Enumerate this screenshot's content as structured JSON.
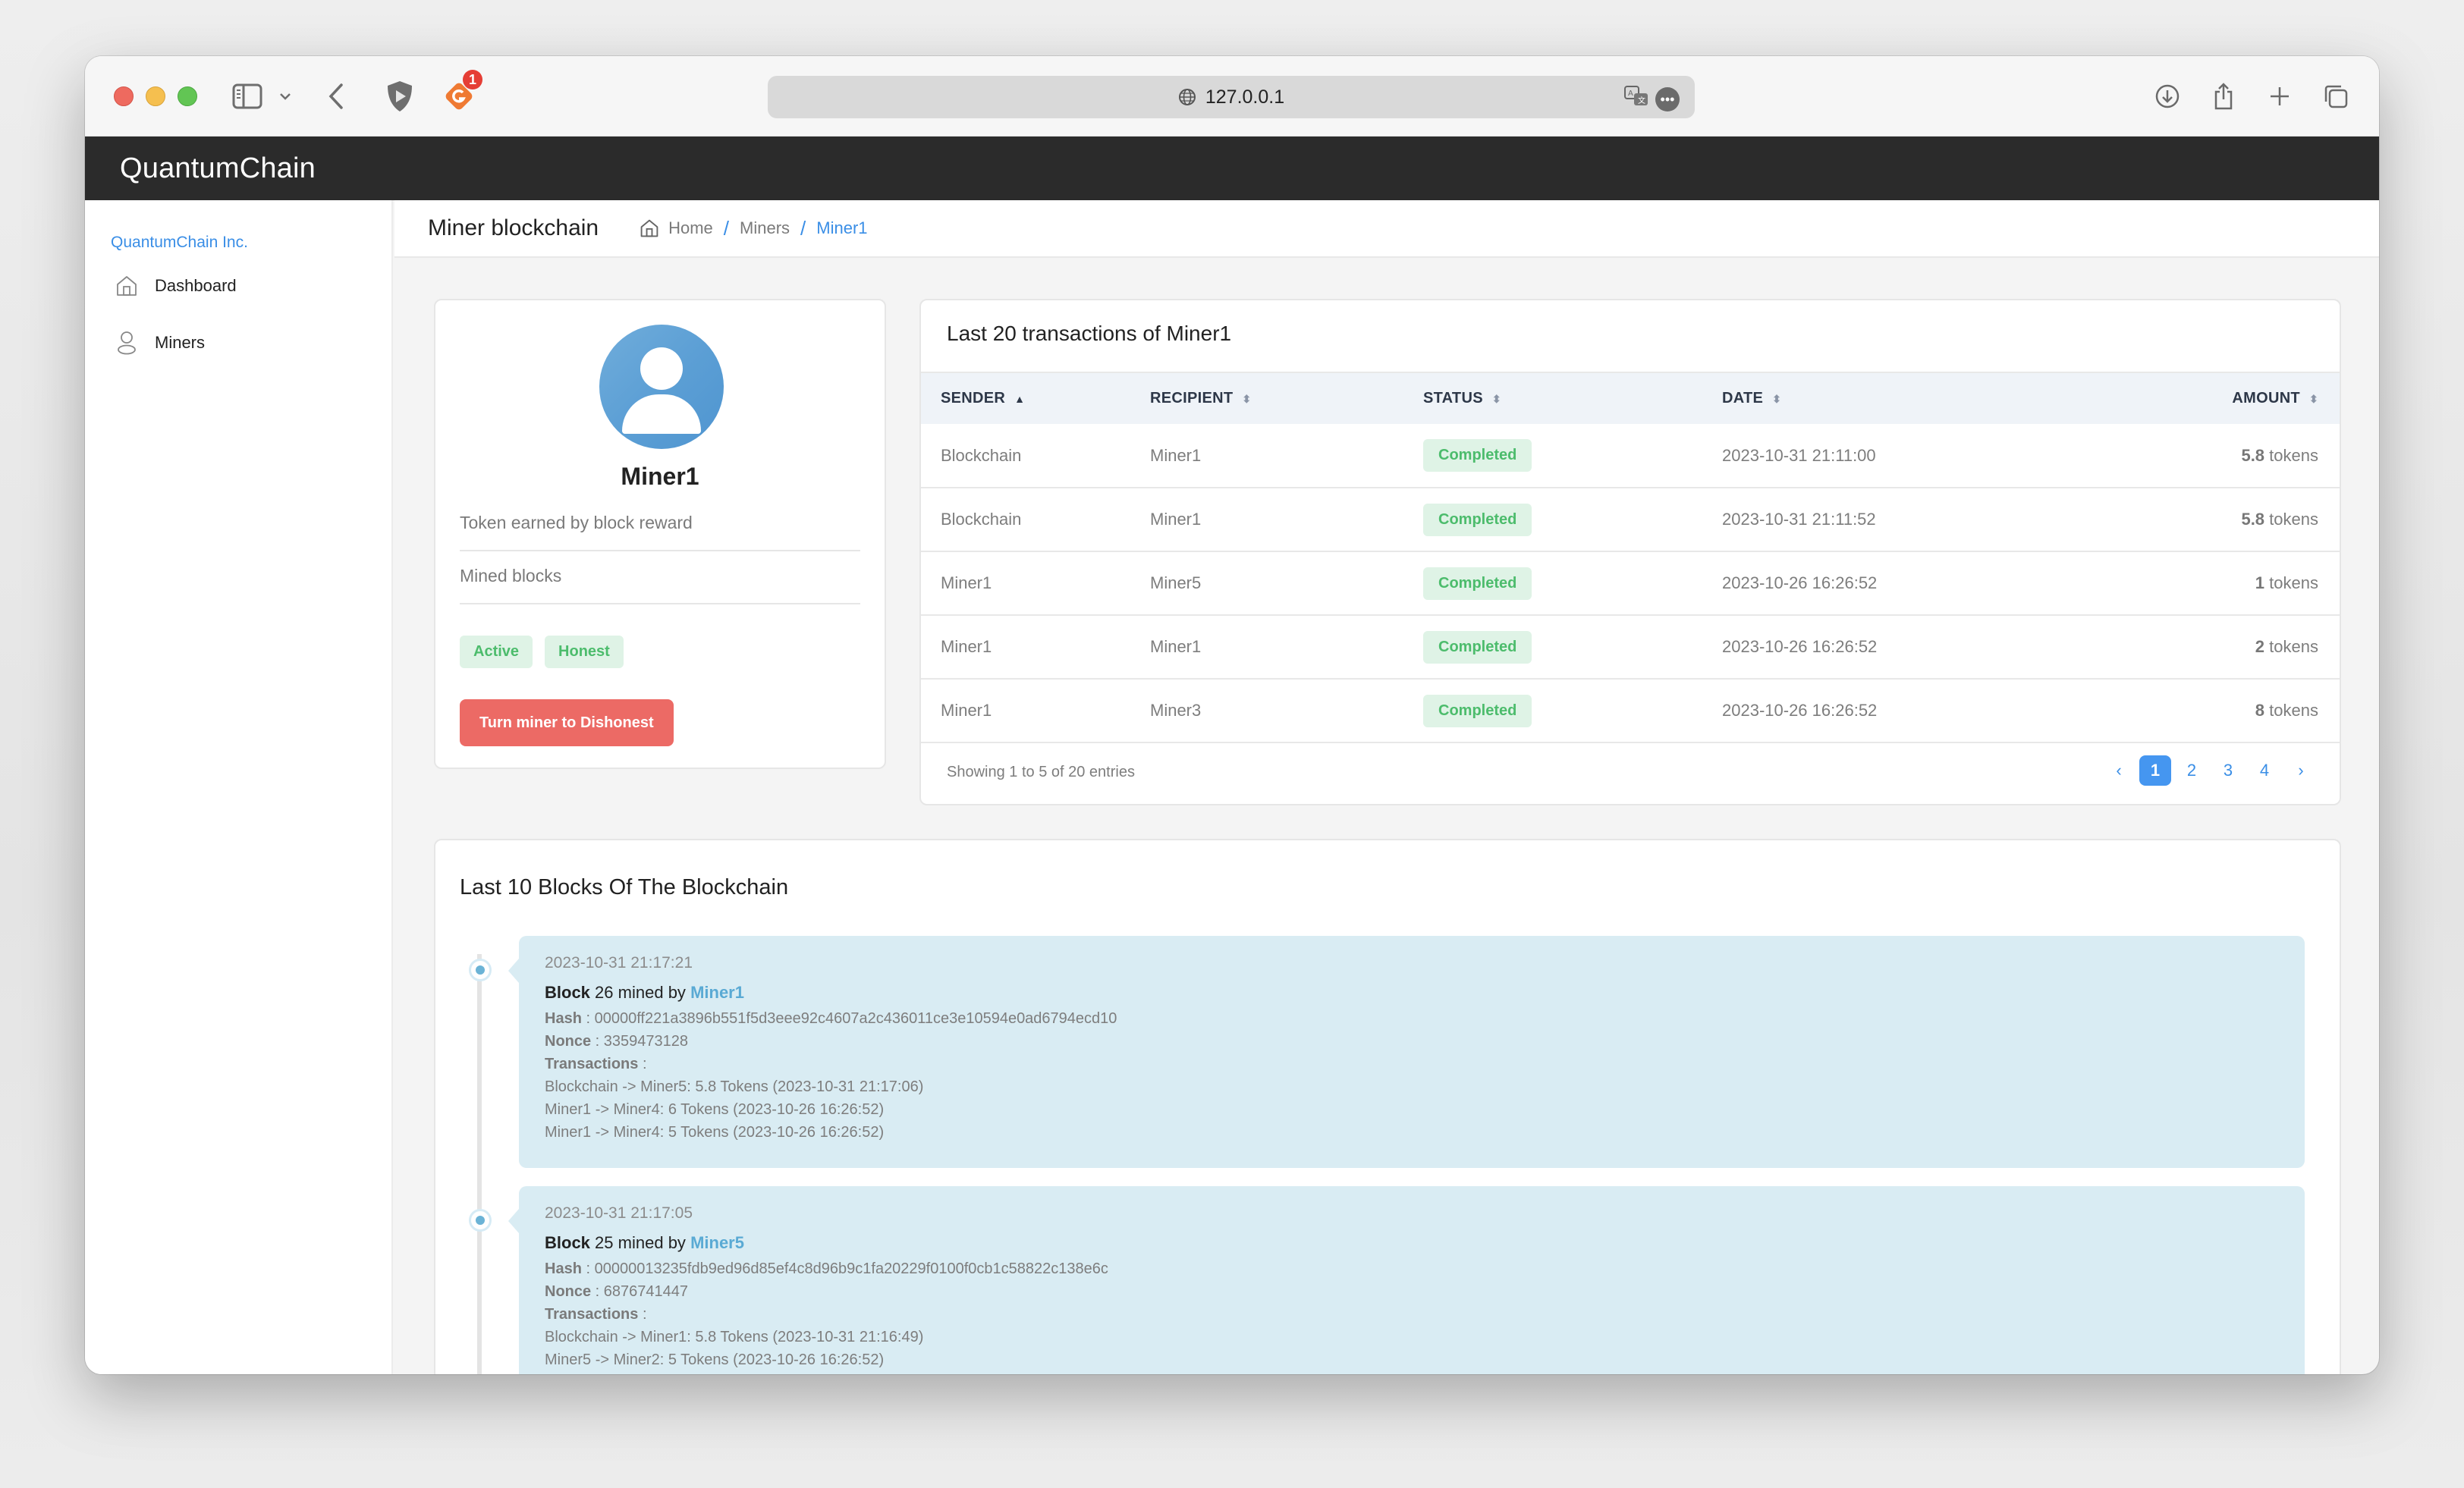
{
  "browser": {
    "url": "127.0.0.1",
    "extension_badge_count": "1"
  },
  "navbar": {
    "brand": "QuantumChain"
  },
  "sidebar": {
    "company": "QuantumChain Inc.",
    "items": [
      {
        "label": "Dashboard",
        "icon": "home-icon"
      },
      {
        "label": "Miners",
        "icon": "user-icon"
      }
    ]
  },
  "header": {
    "title": "Miner blockchain",
    "breadcrumb": [
      "Home",
      "Miners",
      "Miner1"
    ]
  },
  "profile": {
    "name": "Miner1",
    "reward_label": "Token earned by block reward",
    "mined_label": "Mined blocks",
    "tags": [
      "Active",
      "Honest"
    ],
    "action_label": "Turn miner to Dishonest",
    "colors": {
      "tag_text": "#4cbc6c",
      "tag_bg": "#dff3e6",
      "danger": "#ec6a65"
    }
  },
  "transactions": {
    "title": "Last 20 transactions of Miner1",
    "columns": [
      "SENDER",
      "RECIPIENT",
      "STATUS",
      "DATE",
      "AMOUNT"
    ],
    "sorted_column": "SENDER",
    "sort_direction": "asc",
    "rows": [
      {
        "sender": "Blockchain",
        "recipient": "Miner1",
        "status": "Completed",
        "date": "2023-10-31 21:11:00",
        "amount": "5.8",
        "unit": "tokens"
      },
      {
        "sender": "Blockchain",
        "recipient": "Miner1",
        "status": "Completed",
        "date": "2023-10-31 21:11:52",
        "amount": "5.8",
        "unit": "tokens"
      },
      {
        "sender": "Miner1",
        "recipient": "Miner5",
        "status": "Completed",
        "date": "2023-10-26 16:26:52",
        "amount": "1",
        "unit": "tokens"
      },
      {
        "sender": "Miner1",
        "recipient": "Miner1",
        "status": "Completed",
        "date": "2023-10-26 16:26:52",
        "amount": "2",
        "unit": "tokens"
      },
      {
        "sender": "Miner1",
        "recipient": "Miner3",
        "status": "Completed",
        "date": "2023-10-26 16:26:52",
        "amount": "8",
        "unit": "tokens"
      }
    ],
    "footer": "Showing 1 to 5 of 20 entries",
    "pagination": {
      "prev": "‹",
      "pages": [
        "1",
        "2",
        "3",
        "4"
      ],
      "current": "1",
      "next": "›"
    }
  },
  "blocks": {
    "title": "Last 10 Blocks Of The Blockchain",
    "labels": {
      "block": "Block",
      "mined_by": "mined by",
      "hash": "Hash",
      "nonce": "Nonce",
      "transactions": "Transactions",
      "sep": " : "
    },
    "items": [
      {
        "date": "2023-10-31 21:17:21",
        "number": "26",
        "miner": "Miner1",
        "hash": "00000ff221a3896b551f5d3eee92c4607a2c436011ce3e10594e0ad6794ecd10",
        "nonce": "3359473128",
        "transactions": [
          "Blockchain -> Miner5: 5.8 Tokens (2023-10-31 21:17:06)",
          "Miner1 -> Miner4: 6 Tokens (2023-10-26 16:26:52)",
          "Miner1 -> Miner4: 5 Tokens (2023-10-26 16:26:52)"
        ]
      },
      {
        "date": "2023-10-31 21:17:05",
        "number": "25",
        "miner": "Miner5",
        "hash": "00000013235fdb9ed96d85ef4c8d96b9c1fa20229f0100f0cb1c58822c138e6c",
        "nonce": "6876741447",
        "transactions": [
          "Blockchain -> Miner1: 5.8 Tokens (2023-10-31 21:16:49)",
          "Miner5 -> Miner2: 5 Tokens (2023-10-26 16:26:52)"
        ]
      }
    ]
  }
}
